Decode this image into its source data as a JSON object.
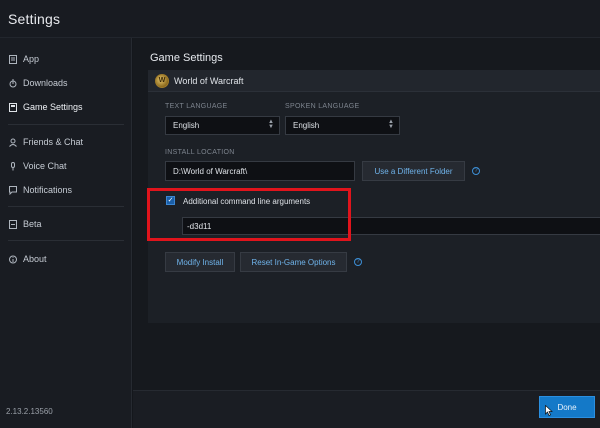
{
  "window": {
    "title": "Settings"
  },
  "sidebar": {
    "items": [
      {
        "label": "App",
        "icon": "app-icon"
      },
      {
        "label": "Downloads",
        "icon": "downloads-icon"
      },
      {
        "label": "Game Settings",
        "icon": "game-settings-icon",
        "active": true
      },
      {
        "label": "Friends & Chat",
        "icon": "friends-icon"
      },
      {
        "label": "Voice Chat",
        "icon": "microphone-icon"
      },
      {
        "label": "Notifications",
        "icon": "notifications-icon"
      },
      {
        "label": "Beta",
        "icon": "beta-icon"
      },
      {
        "label": "About",
        "icon": "info-icon"
      }
    ],
    "version": "2.13.2.13560"
  },
  "main": {
    "section_title": "Game Settings",
    "game": {
      "name": "World of Warcraft",
      "text_language": {
        "label": "TEXT LANGUAGE",
        "value": "English"
      },
      "spoken_language": {
        "label": "SPOKEN LANGUAGE",
        "value": "English"
      },
      "install_location": {
        "label": "INSTALL LOCATION",
        "value": "D:\\World of Warcraft\\",
        "change_button": "Use a Different Folder"
      },
      "command_line": {
        "label": "Additional command line arguments",
        "checked": true,
        "value": "-d3d11"
      },
      "modify_button": "Modify Install",
      "reset_button": "Reset In-Game Options"
    }
  },
  "footer": {
    "done_label": "Done"
  },
  "colors": {
    "accent": "#1479c8",
    "link": "#6fb3ea",
    "highlight_box": "#e0141c"
  }
}
